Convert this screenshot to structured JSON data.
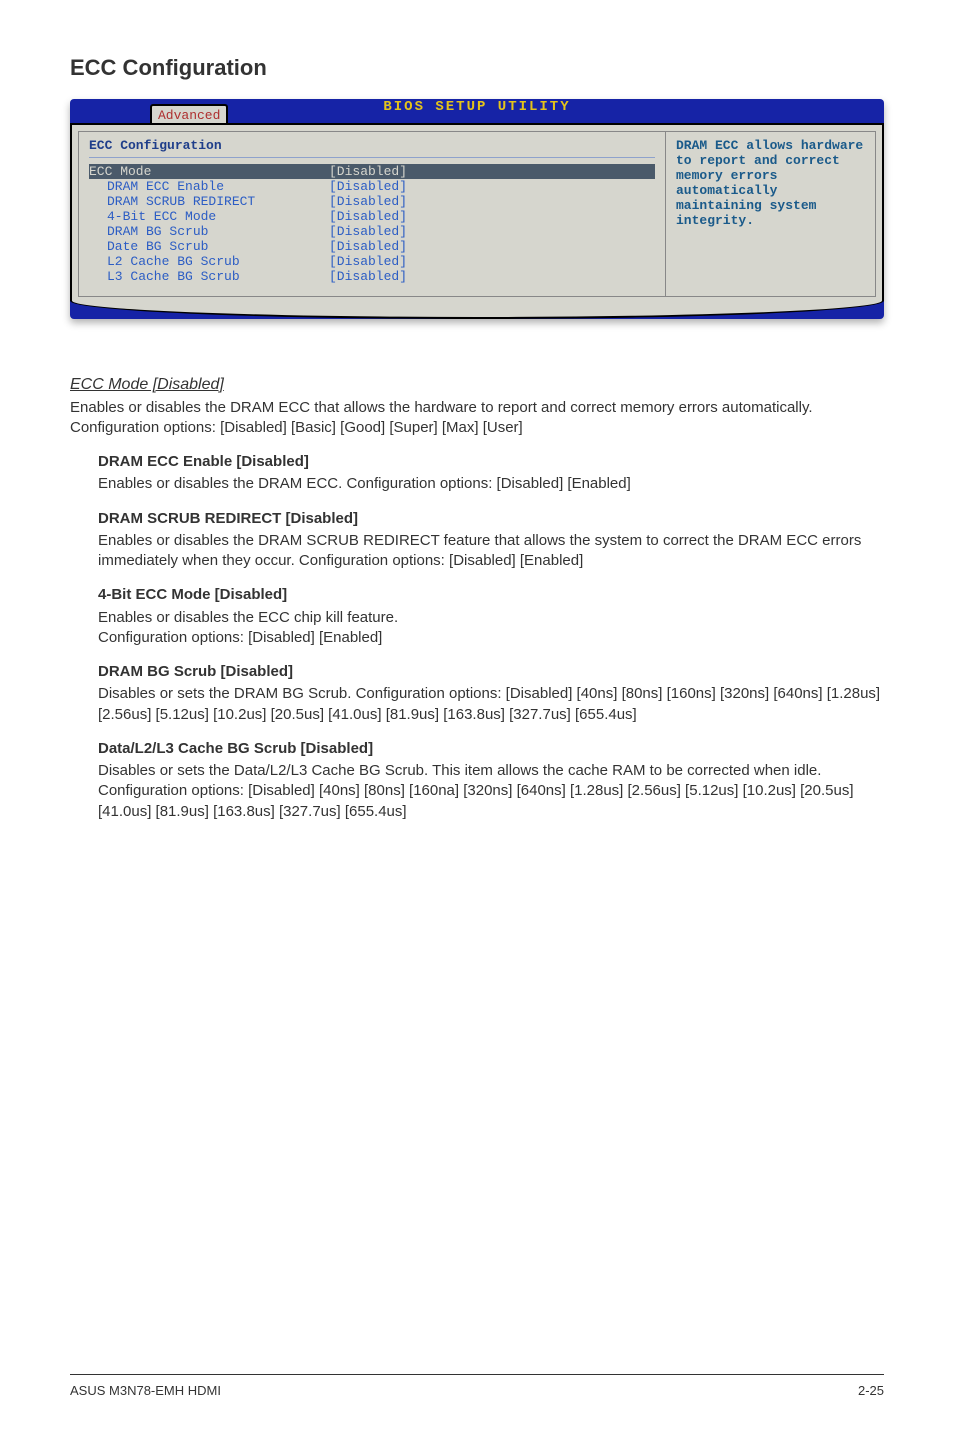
{
  "heading": "ECC Configuration",
  "bios": {
    "titlebar": "BIOS SETUP UTILITY",
    "tab": "Advanced",
    "panel_title": "ECC Configuration",
    "rows": [
      {
        "k": "ECC Mode",
        "v": "[Disabled]",
        "sel": true,
        "sub": false
      },
      {
        "k": "DRAM ECC Enable",
        "v": "[Disabled]",
        "sel": false,
        "sub": true
      },
      {
        "k": "DRAM SCRUB REDIRECT",
        "v": "[Disabled]",
        "sel": false,
        "sub": true
      },
      {
        "k": "4-Bit ECC Mode",
        "v": "[Disabled]",
        "sel": false,
        "sub": true
      },
      {
        "k": "DRAM BG Scrub",
        "v": "[Disabled]",
        "sel": false,
        "sub": true
      },
      {
        "k": "Date BG Scrub",
        "v": "[Disabled]",
        "sel": false,
        "sub": true
      },
      {
        "k": "L2 Cache BG Scrub",
        "v": "[Disabled]",
        "sel": false,
        "sub": true
      },
      {
        "k": "L3 Cache BG Scrub",
        "v": "[Disabled]",
        "sel": false,
        "sub": true
      }
    ],
    "help": "DRAM ECC allows hardware to report and correct memory errors automatically maintaining system integrity."
  },
  "sections": {
    "ecc_mode": {
      "title": "ECC Mode [Disabled]",
      "body": "Enables or disables the DRAM ECC that allows the hardware to report and correct memory errors automatically. Configuration options: [Disabled] [Basic] [Good] [Super] [Max] [User]"
    },
    "dram_ecc": {
      "title": "DRAM ECC Enable [Disabled]",
      "body": "Enables or disables the DRAM ECC. Configuration options: [Disabled] [Enabled]"
    },
    "scrub_redirect": {
      "title": "DRAM SCRUB REDIRECT [Disabled]",
      "body": "Enables or disables the DRAM SCRUB REDIRECT feature that allows the system to correct the DRAM ECC errors immediately when they occur. Configuration options: [Disabled] [Enabled]"
    },
    "fourbit": {
      "title": "4-Bit ECC Mode [Disabled]",
      "body1": "Enables or disables the ECC chip kill feature.",
      "body2": "Configuration options: [Disabled] [Enabled]"
    },
    "bg_scrub": {
      "title": "DRAM BG Scrub [Disabled]",
      "body": "Disables or sets the DRAM BG Scrub. Configuration options: [Disabled] [40ns] [80ns] [160ns] [320ns] [640ns] [1.28us] [2.56us] [5.12us] [10.2us] [20.5us] [41.0us] [81.9us] [163.8us] [327.7us] [655.4us]"
    },
    "data_cache": {
      "title": "Data/L2/L3 Cache BG Scrub [Disabled]",
      "body": "Disables or sets the Data/L2/L3 Cache BG Scrub. This item allows the cache RAM to be corrected when idle. Configuration options: [Disabled] [40ns] [80ns] [160na] [320ns] [640ns] [1.28us] [2.56us] [5.12us] [10.2us] [20.5us] [41.0us] [81.9us] [163.8us] [327.7us] [655.4us]"
    }
  },
  "footer": {
    "left": "ASUS M3N78-EMH HDMI",
    "right": "2-25"
  }
}
